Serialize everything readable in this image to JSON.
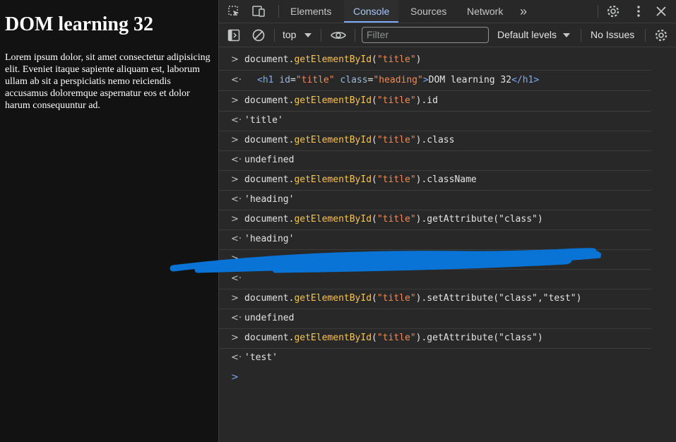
{
  "page": {
    "heading": "DOM learning 32",
    "paragraph": "Lorem ipsum dolor, sit amet consectetur adipisicing elit. Eveniet itaque sapiente aliquam est, laborum ullam ab sit a perspiciatis nemo reiciendis accusamus doloremque aspernatur eos et dolor harum consequuntur ad."
  },
  "devtools": {
    "tabs": [
      "Elements",
      "Console",
      "Sources",
      "Network"
    ],
    "active_tab": "Console",
    "more_tabs_glyph": "»",
    "toolbar": {
      "context": "top",
      "filter_placeholder": "Filter",
      "levels": "Default levels",
      "issues": "No Issues"
    },
    "icons": [
      "inspect-icon",
      "device-toggle-icon",
      "settings-icon",
      "more-vert-icon",
      "close-icon",
      "sidebar-icon",
      "clear-console-icon",
      "eye-icon",
      "console-settings-icon"
    ],
    "colors": {
      "function": "#f6c452",
      "string": "#f28b54",
      "result": "#5cd5fb",
      "undefined": "#8e918f",
      "tag": "#7cacf8",
      "redaction": "#0a74d6"
    }
  },
  "console": {
    "rows": [
      {
        "type": "input",
        "obj": "document.",
        "fn": "getElementById",
        "p1": "(",
        "s1": "\"title\"",
        "p2": ")",
        "rest": ""
      },
      {
        "type": "element",
        "lt": "<",
        "tag": "h1",
        "sp1": " ",
        "a1": "id",
        "eq1": "=",
        "v1": "\"title\"",
        "sp2": " ",
        "a2": "class",
        "eq2": "=",
        "v2": "\"heading\"",
        "gt": ">",
        "text": "DOM learning 32",
        "close": "</h1>"
      },
      {
        "type": "input",
        "obj": "document.",
        "fn": "getElementById",
        "p1": "(",
        "s1": "\"title\"",
        "p2": ")",
        "rest": ".id"
      },
      {
        "type": "result",
        "value": "'title'"
      },
      {
        "type": "input",
        "obj": "document.",
        "fn": "getElementById",
        "p1": "(",
        "s1": "\"title\"",
        "p2": ")",
        "rest": ".class"
      },
      {
        "type": "undefined",
        "value": "undefined"
      },
      {
        "type": "input",
        "obj": "document.",
        "fn": "getElementById",
        "p1": "(",
        "s1": "\"title\"",
        "p2": ")",
        "rest": ".className"
      },
      {
        "type": "result",
        "value": "'heading'"
      },
      {
        "type": "input",
        "obj": "document.",
        "fn": "getElementById",
        "p1": "(",
        "s1": "\"title\"",
        "p2": ")",
        "rest": ".getAttribute(\"class\")"
      },
      {
        "type": "result",
        "value": "'heading'"
      },
      {
        "type": "redacted"
      },
      {
        "type": "redacted"
      },
      {
        "type": "input",
        "obj": "document.",
        "fn": "getElementById",
        "p1": "(",
        "s1": "\"title\"",
        "p2": ")",
        "rest": ".setAttribute(\"class\",\"test\")"
      },
      {
        "type": "undefined",
        "value": "undefined"
      },
      {
        "type": "input",
        "obj": "document.",
        "fn": "getElementById",
        "p1": "(",
        "s1": "\"title\"",
        "p2": ")",
        "rest": ".getAttribute(\"class\")"
      },
      {
        "type": "result",
        "value": "'test'"
      }
    ],
    "prompt_glyph": ">",
    "result_glyph": "<·",
    "input_glyph": ">"
  }
}
